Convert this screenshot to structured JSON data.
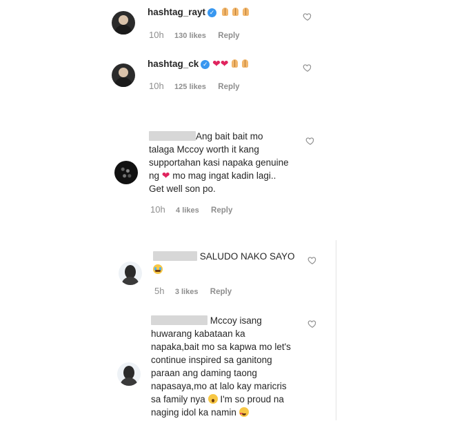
{
  "comments": [
    {
      "username": "hashtag_rayt",
      "verified": true,
      "lines": [
        "🙏🙏🙏"
      ],
      "time": "10h",
      "likes": "130 likes",
      "reply": "Reply"
    },
    {
      "username": "hashtag_ck",
      "verified": true,
      "lines": [
        "❤❤🙏🙏"
      ],
      "time": "10h",
      "likes": "125 likes",
      "reply": "Reply"
    },
    {
      "username": "",
      "redacted": true,
      "lines": [
        "Ang bait bait mo",
        "talaga Mccoy worth it kang",
        "supportahan kasi napaka genuine",
        "ng",
        "mo mag ingat kadin lagi..",
        "Get well son po."
      ],
      "time": "10h",
      "likes": "4 likes",
      "reply": "Reply"
    },
    {
      "username": "",
      "redacted": true,
      "lines": [
        "SALUDO NAKO SAYO"
      ],
      "time": "5h",
      "likes": "3 likes",
      "reply": "Reply"
    },
    {
      "username": "",
      "redacted": true,
      "lines": [
        "Mccoy isang",
        "huwarang kabataan ka",
        "napaka,bait mo sa kapwa mo let's",
        "continue inspired sa ganitong",
        "paraan ang daming taong",
        "napasaya,mo at lalo kay maricris",
        "sa family nya",
        "I'm so proud na",
        "naging idol ka namin"
      ]
    }
  ],
  "icons": {
    "verified": "verified-badge-icon",
    "like": "heart-outline-icon",
    "pray": "folded-hands-emoji",
    "red_heart": "red-heart-emoji",
    "crying": "crying-face-emoji",
    "scream": "screaming-face-emoji",
    "heart_eyes": "heart-eyes-emoji"
  }
}
